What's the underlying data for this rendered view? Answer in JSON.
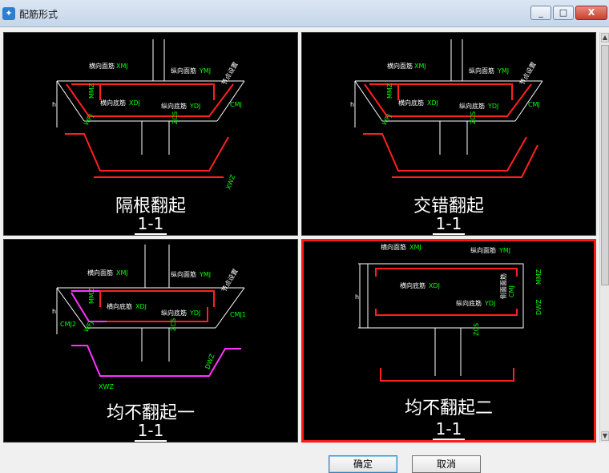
{
  "window": {
    "title": "配筋形式",
    "controls": {
      "minimize": "_",
      "maximize": "□",
      "close": "X"
    }
  },
  "options": [
    {
      "title": "隔根翻起",
      "section": "1-1",
      "labels": {
        "top_transverse": "横向面筋",
        "top_transverse_code": "XMJ",
        "top_longitudinal": "纵向面筋",
        "top_longitudinal_code": "YMJ",
        "bottom_transverse": "横向底筋",
        "bottom_transverse_code": "XDJ",
        "bottom_longitudinal": "纵向底筋",
        "bottom_longitudinal_code": "YDJ",
        "slope": "节点设置",
        "cmj": "CMJ",
        "mmz": "MMZ",
        "wfj": "WFJ",
        "zcs": "ZCS",
        "h": "h",
        "xwz": "XWZ"
      }
    },
    {
      "title": "交错翻起",
      "section": "1-1",
      "labels": {
        "top_transverse": "横向面筋",
        "top_transverse_code": "XMJ",
        "top_longitudinal": "纵向面筋",
        "top_longitudinal_code": "YMJ",
        "bottom_transverse": "横向底筋",
        "bottom_transverse_code": "XDJ",
        "bottom_longitudinal": "纵向底筋",
        "bottom_longitudinal_code": "YDJ",
        "slope": "节点设置",
        "cmj": "CMJ",
        "mmz": "MMZ",
        "wfj": "WFJ",
        "zcs": "ZCS",
        "h": "h"
      }
    },
    {
      "title": "均不翻起一",
      "section": "1-1",
      "labels": {
        "top_transverse": "横向面筋",
        "top_transverse_code": "XMJ",
        "top_longitudinal": "纵向面筋",
        "top_longitudinal_code": "YMJ",
        "bottom_transverse": "横向底筋",
        "bottom_transverse_code": "XDJ",
        "bottom_longitudinal": "纵向底筋",
        "bottom_longitudinal_code": "YDJ",
        "slope": "节点设置",
        "cmj1": "CMJ1",
        "cmj2": "CMJ2",
        "mmz": "MMZ",
        "wfj": "WFJ",
        "zcs": "ZCS",
        "h": "h",
        "xwz": "XWZ",
        "dwz": "DWZ"
      }
    },
    {
      "title": "均不翻起二",
      "section": "1-1",
      "selected": true,
      "labels": {
        "top_transverse": "横向面筋",
        "top_transverse_code": "XMJ",
        "top_longitudinal": "纵向面筋",
        "top_longitudinal_code": "YMJ",
        "bottom_transverse": "横向底筋",
        "bottom_transverse_code": "XDJ",
        "bottom_longitudinal": "纵向底筋",
        "bottom_longitudinal_code": "YDJ",
        "side": "侧面面筋",
        "cmj": "CMJ",
        "mmz": "MMZ",
        "dwz": "DWZ",
        "zcs": "ZCS",
        "h": "h"
      }
    }
  ],
  "buttons": {
    "ok": "确定",
    "cancel": "取消"
  },
  "colors": {
    "selection": "#ff1a1a",
    "rebar": "#ff2020",
    "annotation": "#00ff00",
    "alt_rebar": "#ff33ff"
  }
}
